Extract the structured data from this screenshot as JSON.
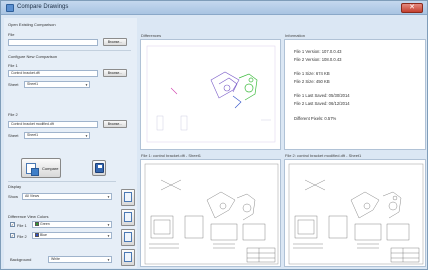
{
  "window": {
    "title": "Compare Drawings",
    "close_glyph": "✕"
  },
  "left": {
    "open_group": "Open Existing Comparison",
    "file_label": "File",
    "file_value": "",
    "browse": "Browse...",
    "new_group": "Configure New Comparison",
    "file1_label": "File 1",
    "file1_value": "Control bracket.dft",
    "browse1": "Browse...",
    "sheet_label": "Sheet",
    "sheet1_value": "Sheet1",
    "file2_label": "File 2",
    "file2_value": "Control bracket modified.dft",
    "browse2": "Browse...",
    "sheet2_value": "Sheet1",
    "compare": "Compare",
    "display_label": "Display",
    "show_label": "Show",
    "show_value": "All Views",
    "diff_group": "Difference View Colors",
    "file1_color_label": "File 1",
    "file1_color": "Green",
    "file2_color_label": "File 2",
    "file2_color": "Blue",
    "background_label": "Background",
    "background_value": "White",
    "check_glyph": "✓",
    "arrow_glyph": "▼"
  },
  "colors": {
    "file1": "#2e9a2e",
    "file2": "#2e4ec8",
    "background": "#ffffff"
  },
  "panels": {
    "difference_title": "Differences",
    "information_title": "Information",
    "file1_view_title": "File 1: control bracket.dft - Sheet1",
    "file2_view_title": "File 2: control bracket modified.dft - Sheet1"
  },
  "info": {
    "file1_version": "File 1 Version: 107.0.0.43",
    "file2_version": "File 2 Version: 108.0.0.43",
    "file1_size": "File 1 Size: 674 KB",
    "file2_size": "File 2 Size: 450 KB",
    "file1_saved": "File 1 Last Saved: 05/30/2014",
    "file2_saved": "File 2 Last Saved: 06/12/2014",
    "diff_pixels": "Different Pixels: 0.57%"
  },
  "tools": [
    "zoom-fit-icon",
    "zoom-window-icon",
    "pan-icon",
    "zoom-icon"
  ]
}
